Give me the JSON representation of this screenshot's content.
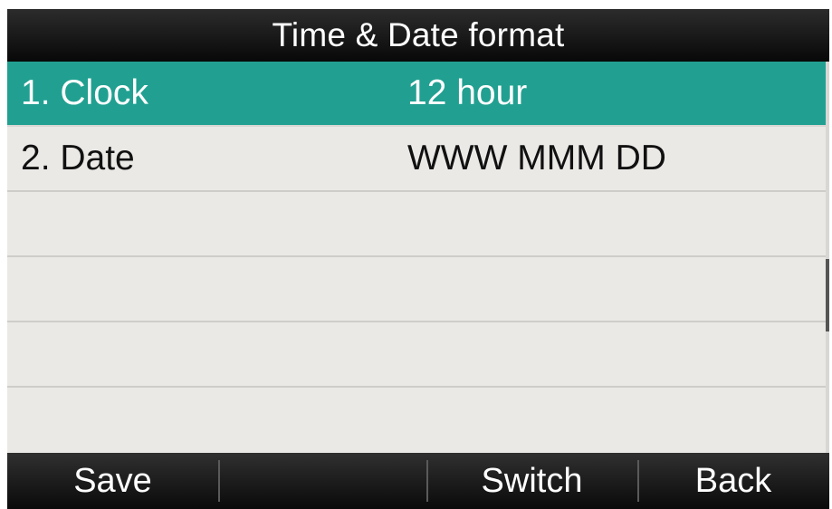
{
  "header": {
    "title": "Time & Date format"
  },
  "list": {
    "items": [
      {
        "label": "1. Clock",
        "value": "12 hour",
        "selected": true
      },
      {
        "label": "2. Date",
        "value": "WWW MMM DD",
        "selected": false
      },
      {
        "label": "",
        "value": "",
        "selected": false
      },
      {
        "label": "",
        "value": "",
        "selected": false
      },
      {
        "label": "",
        "value": "",
        "selected": false
      },
      {
        "label": "",
        "value": "",
        "selected": false
      }
    ]
  },
  "softkeys": {
    "key1": "Save",
    "key2": "",
    "key3": "Switch",
    "key4": "Back"
  },
  "colors": {
    "selection": "#21a091",
    "background": "#ebe9e6",
    "bars": "#111111"
  }
}
